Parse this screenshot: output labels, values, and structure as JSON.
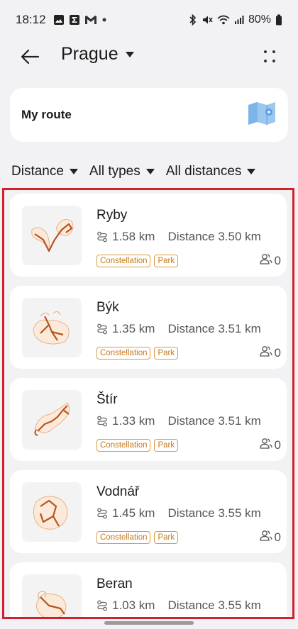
{
  "status": {
    "time": "18:12",
    "battery": "80%",
    "left_icons": [
      "gallery-icon",
      "sigma-app-icon",
      "gmail-icon",
      "dot-icon"
    ],
    "right_icons": [
      "bluetooth-icon",
      "mute-icon",
      "wifi-icon",
      "signal-icon",
      "battery-icon"
    ]
  },
  "header": {
    "city": "Prague"
  },
  "route_card": {
    "label": "My route",
    "icon": "map-icon"
  },
  "filters": [
    {
      "label": "Distance"
    },
    {
      "label": "All types"
    },
    {
      "label": "All distances"
    }
  ],
  "items": [
    {
      "name": "Ryby",
      "length": "1.58 km",
      "distance": "Distance 3.50 km",
      "tags": [
        "Constellation",
        "Park"
      ],
      "likes": "0",
      "icon": "pisces-constellation-icon"
    },
    {
      "name": "Býk",
      "length": "1.35 km",
      "distance": "Distance 3.51 km",
      "tags": [
        "Constellation",
        "Park"
      ],
      "likes": "0",
      "icon": "taurus-constellation-icon"
    },
    {
      "name": "Štír",
      "length": "1.33 km",
      "distance": "Distance 3.51 km",
      "tags": [
        "Constellation",
        "Park"
      ],
      "likes": "0",
      "icon": "scorpio-constellation-icon"
    },
    {
      "name": "Vodnář",
      "length": "1.45 km",
      "distance": "Distance 3.55 km",
      "tags": [
        "Constellation",
        "Park"
      ],
      "likes": "0",
      "icon": "aquarius-constellation-icon"
    },
    {
      "name": "Beran",
      "length": "1.03 km",
      "distance": "Distance 3.55 km",
      "tags": [],
      "likes": "",
      "icon": "aries-constellation-icon"
    }
  ],
  "colors": {
    "accent": "#c77a1a",
    "highlight_border": "#d2202f",
    "background": "#f2f2f4"
  }
}
